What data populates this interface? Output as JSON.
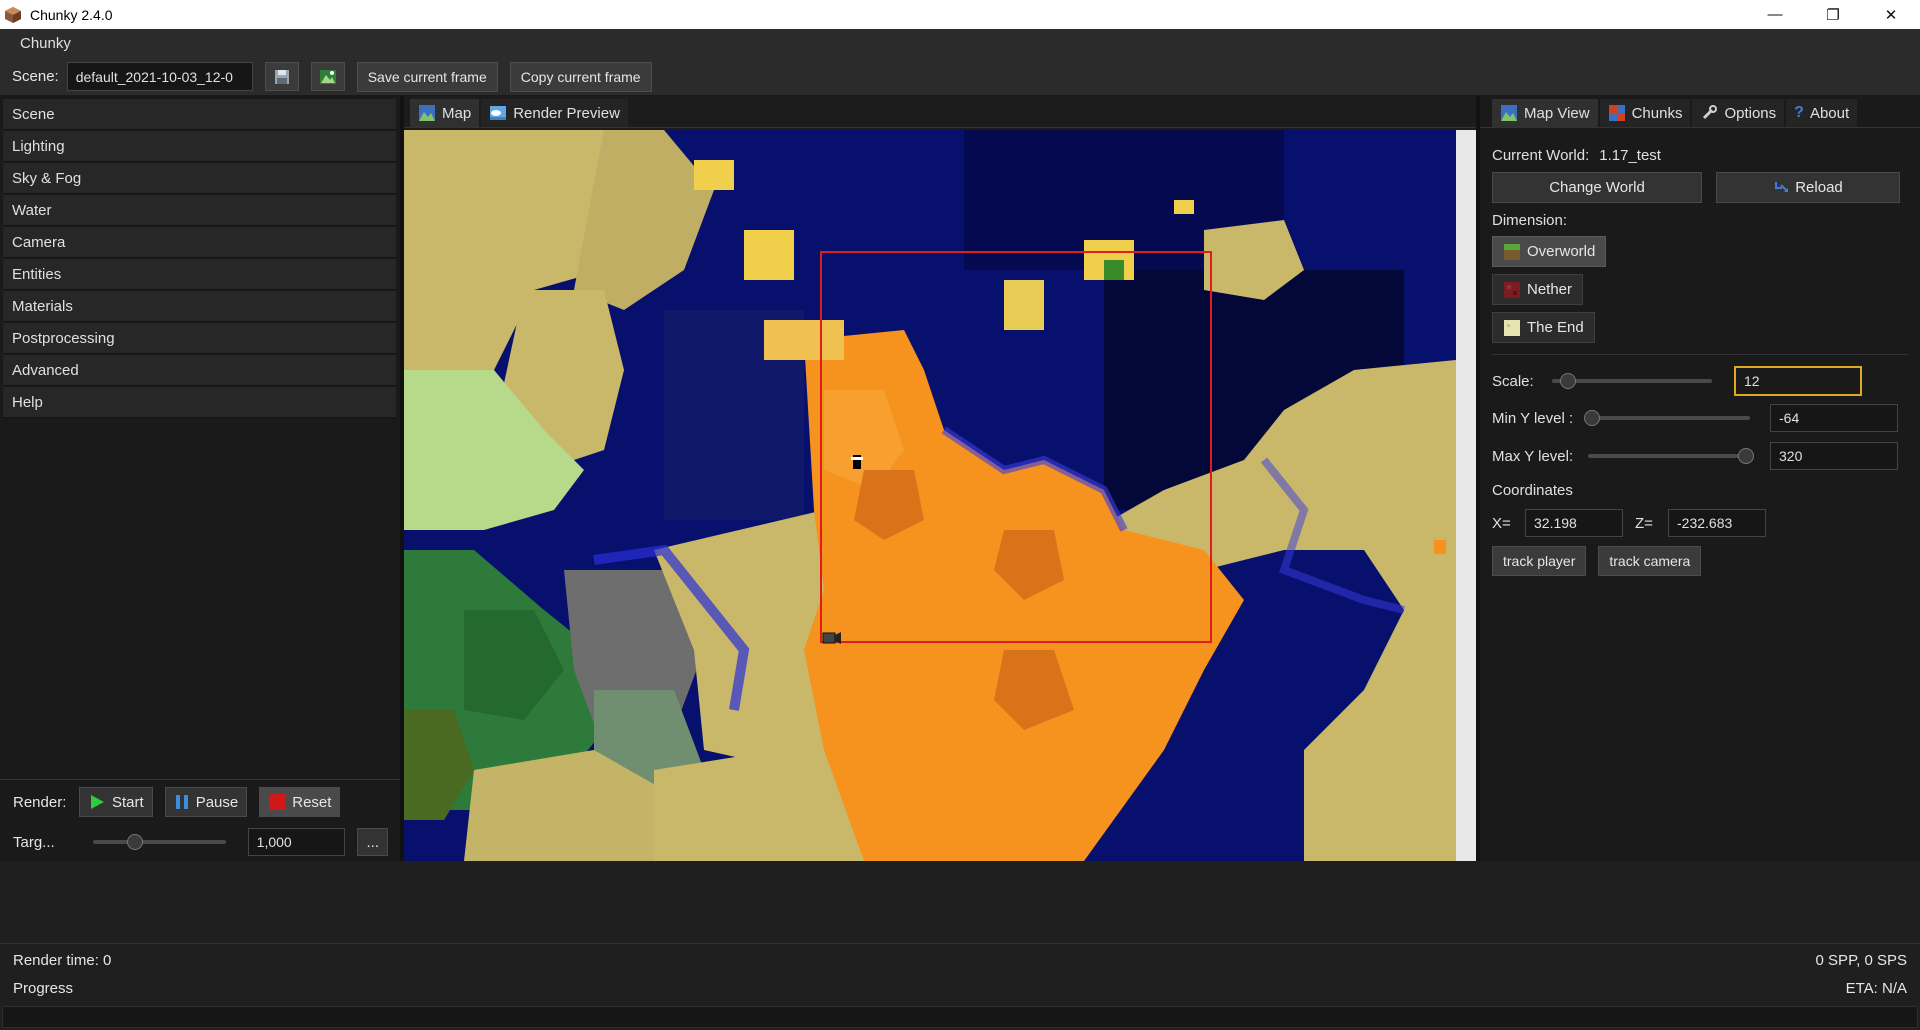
{
  "window": {
    "title": "Chunky 2.4.0",
    "minimize": "—",
    "maximize": "❐",
    "close": "✕"
  },
  "menubar": {
    "items": [
      "Chunky"
    ]
  },
  "toolbar": {
    "scene_label": "Scene:",
    "scene_name": "default_2021-10-03_12-0",
    "save_frame": "Save current frame",
    "copy_frame": "Copy current frame"
  },
  "sidebar": {
    "items": [
      "Scene",
      "Lighting",
      "Sky & Fog",
      "Water",
      "Camera",
      "Entities",
      "Materials",
      "Postprocessing",
      "Advanced",
      "Help"
    ]
  },
  "render": {
    "label": "Render:",
    "start": "Start",
    "pause": "Pause",
    "reset": "Reset",
    "target_label": "Targ...",
    "target_value": "1,000",
    "more": "...",
    "target_slider_fraction": 0.3
  },
  "center_tabs": {
    "map": "Map",
    "preview": "Render Preview"
  },
  "right_tabs": {
    "map_view": "Map View",
    "chunks": "Chunks",
    "options": "Options",
    "about": "About"
  },
  "mapview": {
    "current_world_label": "Current World:",
    "current_world": "1.17_test",
    "change_world": "Change World",
    "reload": "Reload",
    "dimension_label": "Dimension:",
    "dimensions": [
      "Overworld",
      "Nether",
      "The End"
    ],
    "selected_dimension": "Overworld",
    "scale_label": "Scale:",
    "scale_value": "12",
    "scale_slider_fraction": 0.1,
    "min_y_label": "Min Y level :",
    "min_y_value": "-64",
    "min_y_slider_fraction": 0.0,
    "max_y_label": "Max Y level:",
    "max_y_value": "320",
    "max_y_slider_fraction": 1.0,
    "coordinates_label": "Coordinates",
    "x_label": "X=",
    "x_value": "32.198",
    "z_label": "Z=",
    "z_value": "-232.683",
    "track_player": "track player",
    "track_camera": "track camera"
  },
  "status": {
    "render_time": "Render time: 0",
    "spp": "0 SPP, 0 SPS",
    "progress": "Progress",
    "eta": "ETA: N/A"
  },
  "colors": {
    "ocean": "#08106e",
    "deep_ocean": "#050a3a",
    "sand": "#c9b86a",
    "desert": "#f5931e",
    "plains": "#b6d98a",
    "forest": "#2e7a3a",
    "selection": "#e01c1c"
  }
}
